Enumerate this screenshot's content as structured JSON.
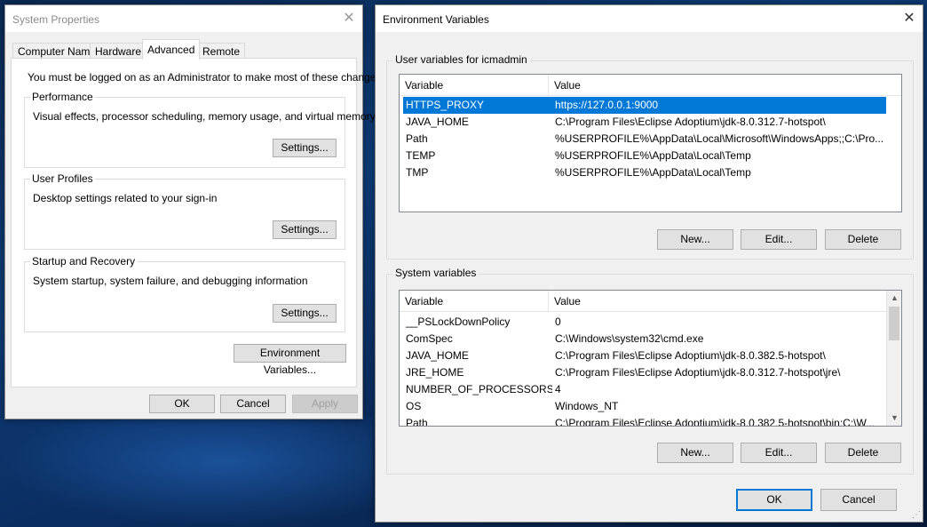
{
  "system_properties": {
    "title": "System Properties",
    "close_glyph": "✕",
    "tabs": [
      "Computer Name",
      "Hardware",
      "Advanced",
      "Remote"
    ],
    "active_tab": "Advanced",
    "admin_notice": "You must be logged on as an Administrator to make most of these changes.",
    "performance": {
      "label": "Performance",
      "description": "Visual effects, processor scheduling, memory usage, and virtual memory",
      "button": "Settings..."
    },
    "user_profiles": {
      "label": "User Profiles",
      "description": "Desktop settings related to your sign-in",
      "button": "Settings..."
    },
    "startup_recovery": {
      "label": "Startup and Recovery",
      "description": "System startup, system failure, and debugging information",
      "button": "Settings..."
    },
    "env_vars_button": "Environment Variables...",
    "ok": "OK",
    "cancel": "Cancel",
    "apply": "Apply"
  },
  "environment_variables": {
    "title": "Environment Variables",
    "close_glyph": "✕",
    "user_section_label": "User variables for icmadmin",
    "columns": {
      "variable": "Variable",
      "value": "Value"
    },
    "user_rows": [
      {
        "variable": "HTTPS_PROXY",
        "value": "https://127.0.0.1:9000",
        "selected": true
      },
      {
        "variable": "JAVA_HOME",
        "value": "C:\\Program Files\\Eclipse Adoptium\\jdk-8.0.312.7-hotspot\\"
      },
      {
        "variable": "Path",
        "value": "%USERPROFILE%\\AppData\\Local\\Microsoft\\WindowsApps;;C:\\Pro..."
      },
      {
        "variable": "TEMP",
        "value": "%USERPROFILE%\\AppData\\Local\\Temp"
      },
      {
        "variable": "TMP",
        "value": "%USERPROFILE%\\AppData\\Local\\Temp"
      }
    ],
    "user_buttons": {
      "new": "New...",
      "edit": "Edit...",
      "delete": "Delete"
    },
    "system_section_label": "System variables",
    "system_rows": [
      {
        "variable": "__PSLockDownPolicy",
        "value": "0"
      },
      {
        "variable": "ComSpec",
        "value": "C:\\Windows\\system32\\cmd.exe"
      },
      {
        "variable": "JAVA_HOME",
        "value": "C:\\Program Files\\Eclipse Adoptium\\jdk-8.0.382.5-hotspot\\"
      },
      {
        "variable": "JRE_HOME",
        "value": "C:\\Program Files\\Eclipse Adoptium\\jdk-8.0.312.7-hotspot\\jre\\"
      },
      {
        "variable": "NUMBER_OF_PROCESSORS",
        "value": "4"
      },
      {
        "variable": "OS",
        "value": "Windows_NT"
      },
      {
        "variable": "Path",
        "value": "C:\\Program Files\\Eclipse Adoptium\\jdk-8.0.382.5-hotspot\\bin;C:\\W..."
      }
    ],
    "system_buttons": {
      "new": "New...",
      "edit": "Edit...",
      "delete": "Delete"
    },
    "ok": "OK",
    "cancel": "Cancel",
    "scroll_up_glyph": "▲",
    "scroll_down_glyph": "▼",
    "resize_grip_glyph": "⋰"
  }
}
